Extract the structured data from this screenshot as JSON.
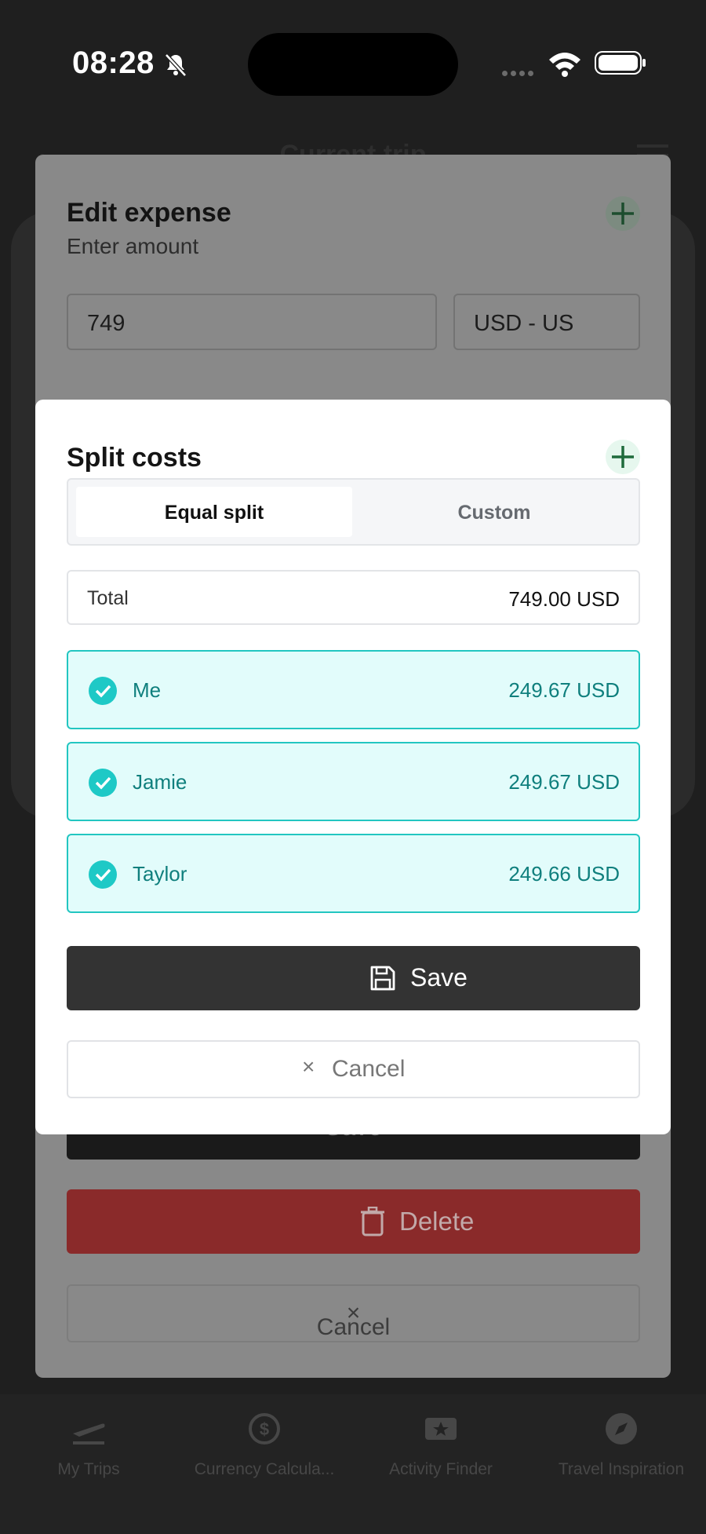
{
  "status_bar": {
    "time": "08:28"
  },
  "background": {
    "header_title": "Current trip",
    "back_icon": "chevron-left-icon",
    "menu_icon": "hamburger-icon"
  },
  "edit_modal": {
    "title": "Edit expense",
    "subtitle": "Enter amount",
    "amount_value": "749",
    "currency_value": "USD - US",
    "save_label": "Save",
    "delete_label": "Delete",
    "cancel_label": "Cancel"
  },
  "split_modal": {
    "title": "Split costs",
    "tabs": [
      {
        "label": "Equal split",
        "active": true
      },
      {
        "label": "Custom",
        "active": false
      }
    ],
    "total_label": "Total",
    "total_value": "749.00 USD",
    "people": [
      {
        "name": "Me",
        "amount": "249.67 USD",
        "checked": true
      },
      {
        "name": "Jamie",
        "amount": "249.67 USD",
        "checked": true
      },
      {
        "name": "Taylor",
        "amount": "249.66 USD",
        "checked": true
      }
    ],
    "save_label": "Save",
    "cancel_label": "Cancel",
    "accent_color": "#1ec9c6"
  },
  "bottom_nav": {
    "items": [
      {
        "label": "My Trips",
        "icon": "plane-departure-icon"
      },
      {
        "label": "Currency Calcula...",
        "icon": "currency-exchange-icon"
      },
      {
        "label": "Activity Finder",
        "icon": "ticket-star-icon"
      },
      {
        "label": "Travel Inspiration",
        "icon": "compass-icon"
      }
    ]
  }
}
